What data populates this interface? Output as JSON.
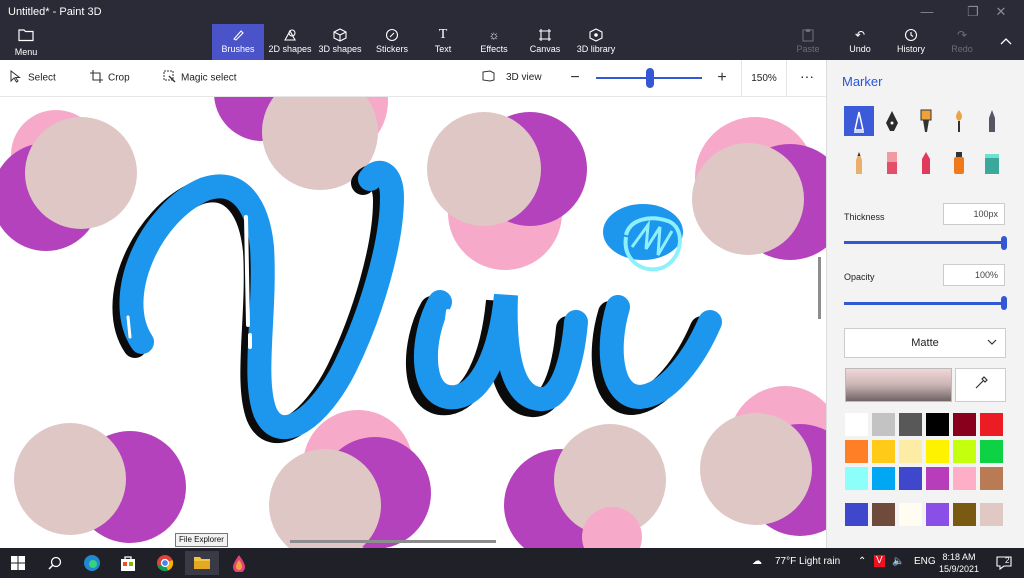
{
  "window": {
    "title": "Untitled* - Paint 3D",
    "minimize": "—",
    "maximize": "❐",
    "close": "✕"
  },
  "menu": {
    "icon": "folder-icon",
    "label": "Menu"
  },
  "ribbon": {
    "tabs": [
      {
        "id": "brushes",
        "label": "Brushes",
        "icon": "brush-icon",
        "active": true
      },
      {
        "id": "2d-shapes",
        "label": "2D shapes",
        "icon": "shapes-2d-icon"
      },
      {
        "id": "3d-shapes",
        "label": "3D shapes",
        "icon": "cube-icon"
      },
      {
        "id": "stickers",
        "label": "Stickers",
        "icon": "sticker-icon"
      },
      {
        "id": "text",
        "label": "Text",
        "icon": "text-icon"
      },
      {
        "id": "effects",
        "label": "Effects",
        "icon": "sun-icon"
      },
      {
        "id": "canvas",
        "label": "Canvas",
        "icon": "canvas-icon"
      },
      {
        "id": "3d-library",
        "label": "3D library",
        "icon": "library-icon"
      }
    ],
    "actions": [
      {
        "id": "paste",
        "label": "Paste",
        "icon": "paste-icon",
        "enabled": false
      },
      {
        "id": "undo",
        "label": "Undo",
        "icon": "undo-icon",
        "enabled": true
      },
      {
        "id": "history",
        "label": "History",
        "icon": "history-icon",
        "enabled": true
      },
      {
        "id": "redo",
        "label": "Redo",
        "icon": "redo-icon",
        "enabled": false
      }
    ],
    "collapse_icon": "chevron-up-icon"
  },
  "toolbar": {
    "select": "Select",
    "crop": "Crop",
    "magic_select": "Magic select",
    "view_3d": "3D view",
    "zoom": "150%",
    "zoom_level": 0.52,
    "more": "···"
  },
  "canvas": {
    "tooltip": "File Explorer",
    "colors": {
      "pink": "#f6a9c9",
      "purple": "#b542bd",
      "beige": "#dfc7c5",
      "blue": "#1d97ee",
      "cyan": "#8ef0fc",
      "black": "#0b0b0b"
    }
  },
  "panel": {
    "title": "Marker",
    "brushes": [
      {
        "name": "marker",
        "selected": true,
        "color": "#ffffff"
      },
      {
        "name": "calligraphy-pen",
        "color": "#2c2c2c"
      },
      {
        "name": "oil-brush",
        "color": "#f0a23a"
      },
      {
        "name": "watercolor",
        "color": "#e8a54a"
      },
      {
        "name": "pixel-pen",
        "color": "#555566"
      },
      {
        "name": "pencil",
        "color": "#e8b06a"
      },
      {
        "name": "eraser",
        "color": "#f19aa0"
      },
      {
        "name": "crayon",
        "color": "#e23a5c"
      },
      {
        "name": "spray-can",
        "color": "#f07a1a"
      },
      {
        "name": "fill",
        "color": "#3aa89a"
      }
    ],
    "thickness": {
      "label": "Thickness",
      "value": "100px",
      "level": 1.0
    },
    "opacity": {
      "label": "Opacity",
      "value": "100%",
      "level": 1.0
    },
    "finish": "Matte",
    "swatches": [
      "#ffffff",
      "#c3c3c3",
      "#585858",
      "#000000",
      "#88001b",
      "#ec1c24",
      "#ff7f27",
      "#ffca18",
      "#fdeca6",
      "#fff200",
      "#c4ff0e",
      "#0ed145",
      "#8cfffb",
      "#00a8f3",
      "#3f48cc",
      "#b83dba",
      "#ffaec8",
      "#b97a56",
      "#3f48cc",
      "#6e4b3b",
      "#fffdf2",
      "#8a4fe6",
      "#7a5a12",
      "#e0c8c5"
    ]
  },
  "taskbar": {
    "apps": [
      {
        "name": "start-icon",
        "glyph": "⊞"
      },
      {
        "name": "search-icon",
        "glyph": "⌕"
      },
      {
        "name": "edge-icon",
        "glyph": "◉"
      },
      {
        "name": "store-icon",
        "glyph": "▣"
      },
      {
        "name": "chrome-icon",
        "glyph": "◎"
      },
      {
        "name": "file-explorer-icon",
        "glyph": "▭"
      },
      {
        "name": "paint-3d-icon",
        "glyph": "◆"
      }
    ],
    "weather": "77°F  Light rain",
    "language": "ENG",
    "time": "8:18 AM",
    "date": "15/9/2021",
    "notifications": "2"
  }
}
